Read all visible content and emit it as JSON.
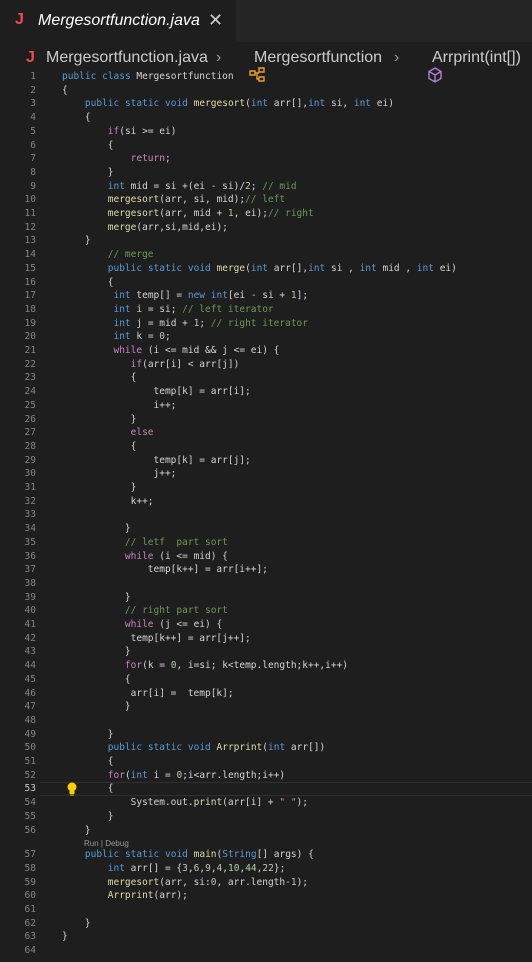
{
  "tab": {
    "icon_letter": "J",
    "title": "Mergesortfunction.java",
    "close": "✕"
  },
  "breadcrumb": {
    "file_icon_letter": "J",
    "file": "Mergesortfunction.java",
    "sep": "›",
    "class_icon": "class-icon",
    "class_name": "Mergesortfunction",
    "method_icon": "method-icon",
    "method_name": "Arrprint(int[])"
  },
  "editor": {
    "active_line": 53,
    "codelens": "Run | Debug",
    "lines": [
      "public class Mergesortfunction",
      "{",
      "    public static void mergesort(int arr[],int si, int ei)",
      "    {",
      "        if(si >= ei)",
      "        {",
      "            return;",
      "        }",
      "        int mid = si +(ei - si)/2; // mid",
      "        mergesort(arr, si, mid);// left",
      "        mergesort(arr, mid + 1, ei);// right",
      "        merge(arr,si,mid,ei);",
      "    }",
      "        // merge",
      "        public static void merge(int arr[],int si , int mid , int ei)",
      "        {",
      "         int temp[] = new int[ei - si + 1];",
      "         int i = si; // left iterator",
      "         int j = mid + 1; // right iterator",
      "         int k = 0;",
      "         while (i <= mid && j <= ei) {",
      "            if(arr[i] < arr[j])",
      "            {",
      "                temp[k] = arr[i];",
      "                i++;",
      "            }",
      "            else",
      "            {",
      "                temp[k] = arr[j];",
      "                j++;",
      "            }",
      "            k++;",
      "",
      "           }",
      "           // letf  part sort",
      "           while (i <= mid) {",
      "               temp[k++] = arr[i++];",
      "",
      "           }",
      "           // right part sort",
      "           while (j <= ei) {",
      "            temp[k++] = arr[j++];",
      "           }",
      "           for(k = 0, i=si; k<temp.length;k++,i++)",
      "           {",
      "            arr[i] =  temp[k];",
      "           }",
      "",
      "        }",
      "        public static void Arrprint(int arr[])",
      "        {",
      "        for(int i = 0;i<arr.length;i++)",
      "        {",
      "            System.out.print(arr[i] + \" \");",
      "        }",
      "    }",
      "    public static void main(String[] args) {",
      "        int arr[] = {3,6,9,4,10,44,22};",
      "        mergesort(arr, si:0, arr.length-1);",
      "        Arrprint(arr);",
      "",
      "    }",
      "}",
      ""
    ]
  },
  "colors": {
    "background": "#1e1e1e",
    "keyword": "#569cd6",
    "control": "#c586c0",
    "function": "#dcdcaa",
    "comment": "#6a9955",
    "number": "#b5cea8",
    "string": "#ce9178",
    "line_number": "#858585"
  }
}
